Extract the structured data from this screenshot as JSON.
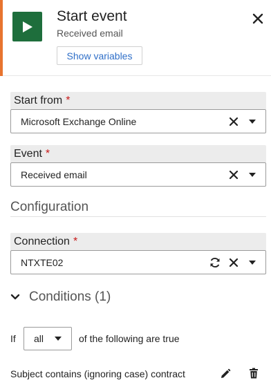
{
  "header": {
    "title": "Start event",
    "subtitle": "Received email",
    "show_variables_label": "Show variables",
    "icons": {
      "play": "play-icon",
      "close": "close-icon"
    },
    "colors": {
      "accent": "#e8742f",
      "play_tile": "#1e6e3c",
      "link": "#2f6fc8"
    }
  },
  "start_from": {
    "label": "Start from",
    "required_mark": "*",
    "value": "Microsoft Exchange Online"
  },
  "event": {
    "label": "Event",
    "required_mark": "*",
    "value": "Received email"
  },
  "configuration": {
    "heading": "Configuration"
  },
  "connection": {
    "label": "Connection",
    "required_mark": "*",
    "value": "NTXTE02"
  },
  "conditions": {
    "heading": "Conditions (1)",
    "if_label": "If",
    "quantifier": "all",
    "following_text": "of the following are true",
    "items": [
      {
        "text": "Subject contains (ignoring case) contract"
      }
    ]
  },
  "colors": {
    "required": "#c81919",
    "label_bar": "#ececec"
  }
}
